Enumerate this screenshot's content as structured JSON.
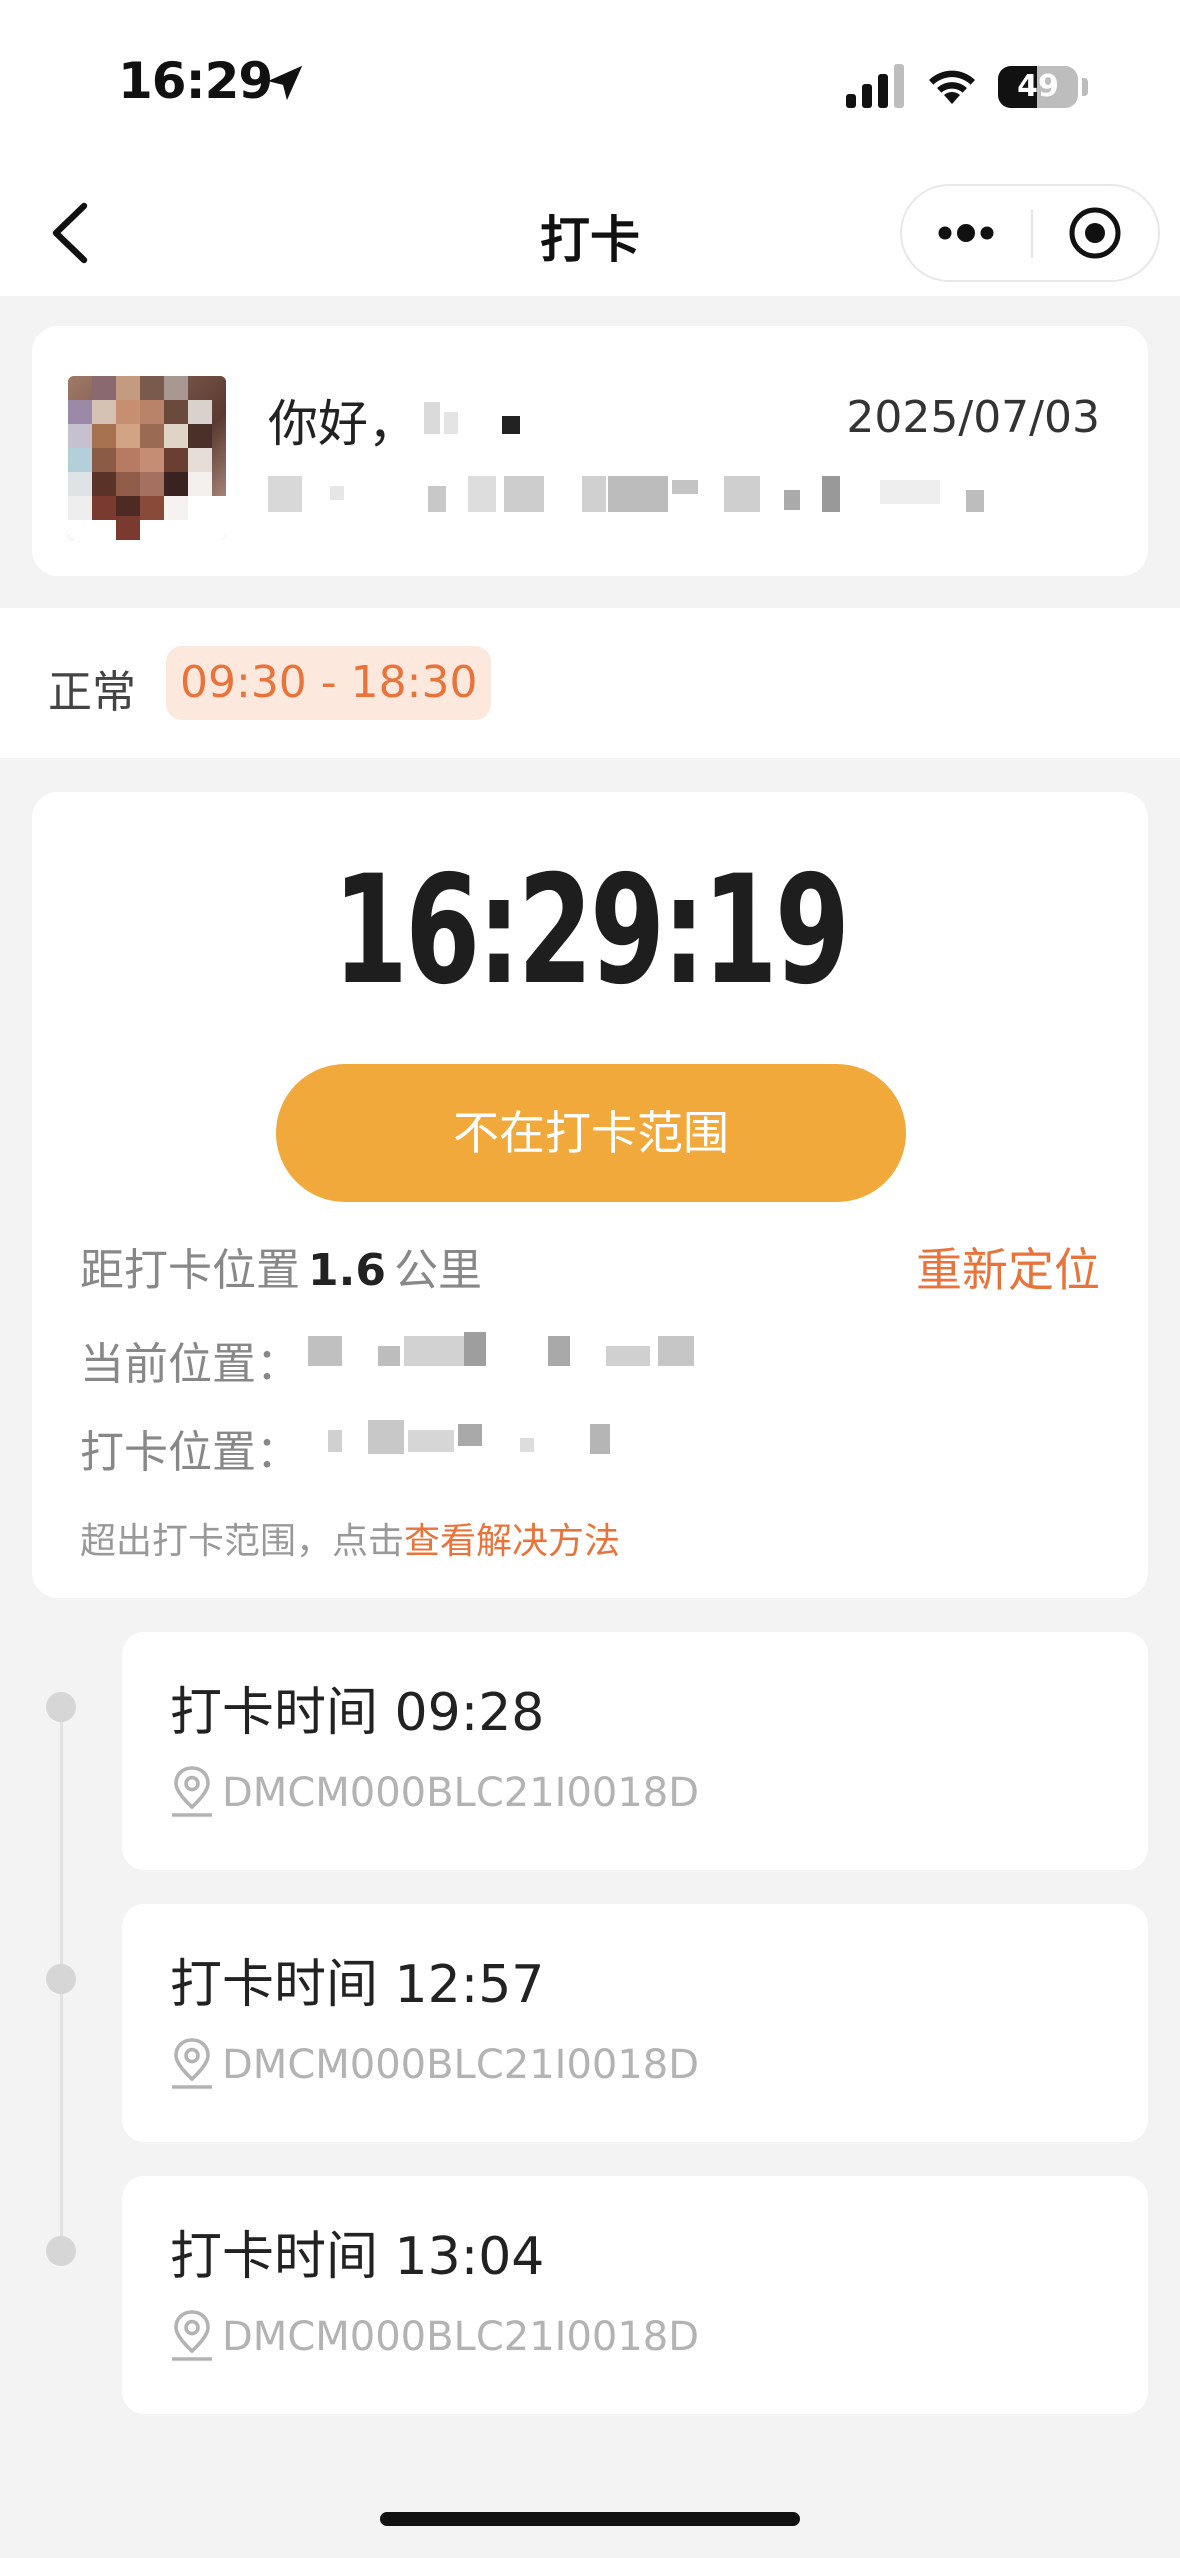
{
  "status_bar": {
    "time": "16:29",
    "battery": "49",
    "battery_level": 0.49
  },
  "nav": {
    "title": "打卡"
  },
  "user": {
    "greeting": "你好，",
    "date": "2025/07/03"
  },
  "schedule": {
    "label": "正常",
    "hours": "09:30 - 18:30"
  },
  "clock": {
    "current_time": "16:29:19",
    "button_label": "不在打卡范围",
    "distance_prefix": "距打卡位置",
    "distance_value": "1.6",
    "distance_unit": "公里",
    "relocate_label": "重新定位",
    "current_location_label": "当前位置：",
    "punch_location_label": "打卡位置：",
    "hint_text": "超出打卡范围，点击",
    "hint_link": "查看解决方法"
  },
  "records": [
    {
      "time_label": "打卡时间 09:28",
      "device": "DMCM000BLC21I0018D"
    },
    {
      "time_label": "打卡时间 12:57",
      "device": "DMCM000BLC21I0018D"
    },
    {
      "time_label": "打卡时间 13:04",
      "device": "DMCM000BLC21I0018D"
    }
  ],
  "colors": {
    "accent": "#e8743b",
    "button": "#f2a93b",
    "badge_bg": "#fde8dd"
  }
}
